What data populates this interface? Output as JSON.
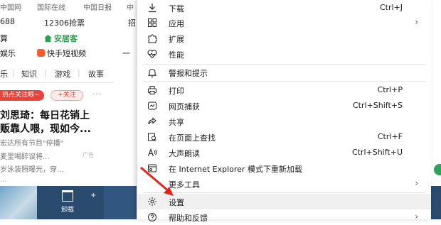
{
  "background": {
    "top_links": [
      "中国网",
      "国际在线",
      "中国日报",
      "中"
    ],
    "row2": [
      "688",
      "12306抢票",
      "招"
    ],
    "row3": [
      "算",
      "安居客"
    ],
    "row4": [
      "娱乐",
      "快手短视频",
      "一"
    ],
    "tabs": [
      "乐",
      "知识",
      "游戏",
      "故事"
    ],
    "hot_pill": "热点关注眼~",
    "follow_pill": "+关注",
    "more_dots": "···",
    "headline1": "刘思琦：每日花销上",
    "headline2": "贩靠人喂，现如今...",
    "sub1": "宏达所有节目\"停播\"",
    "sub2": "麦里喝醉误将...",
    "sub3": "岁泳装照曝光，穿...",
    "sub4": "...",
    "ad_label": "广告",
    "footer_uninstall": "卸载",
    "footer_plus": "+"
  },
  "menu": {
    "items": [
      {
        "label": "下载",
        "shortcut": "Ctrl+J",
        "icon": "download-icon"
      },
      {
        "label": "应用",
        "shortcut": "",
        "icon": "apps-icon",
        "submenu": true
      },
      {
        "label": "扩展",
        "shortcut": "",
        "icon": "extensions-icon"
      },
      {
        "label": "性能",
        "shortcut": "",
        "icon": "performance-icon"
      },
      {
        "label": "警报和提示",
        "shortcut": "",
        "icon": "bell-icon"
      },
      {
        "label": "打印",
        "shortcut": "Ctrl+P",
        "icon": "print-icon"
      },
      {
        "label": "网页捕获",
        "shortcut": "Ctrl+Shift+S",
        "icon": "web-capture-icon"
      },
      {
        "label": "共享",
        "shortcut": "",
        "icon": "share-icon"
      },
      {
        "label": "在页面上查找",
        "shortcut": "Ctrl+F",
        "icon": "find-icon"
      },
      {
        "label": "大声朗读",
        "shortcut": "Ctrl+Shift+U",
        "icon": "read-aloud-icon"
      },
      {
        "label": "在 Internet Explorer 模式下重新加载",
        "shortcut": "",
        "icon": "ie-mode-icon"
      },
      {
        "label": "更多工具",
        "shortcut": "",
        "icon": "more-tools-icon",
        "submenu": true
      },
      {
        "label": "设置",
        "shortcut": "",
        "icon": "settings-icon"
      },
      {
        "label": "帮助和反馈",
        "shortcut": "",
        "icon": "help-icon",
        "submenu": true
      }
    ]
  },
  "colors": {
    "accent_red": "#e8433a",
    "menu_hover": "#f0f0f0",
    "footer": "#2a4a6e",
    "arrow": "#e8231b"
  }
}
